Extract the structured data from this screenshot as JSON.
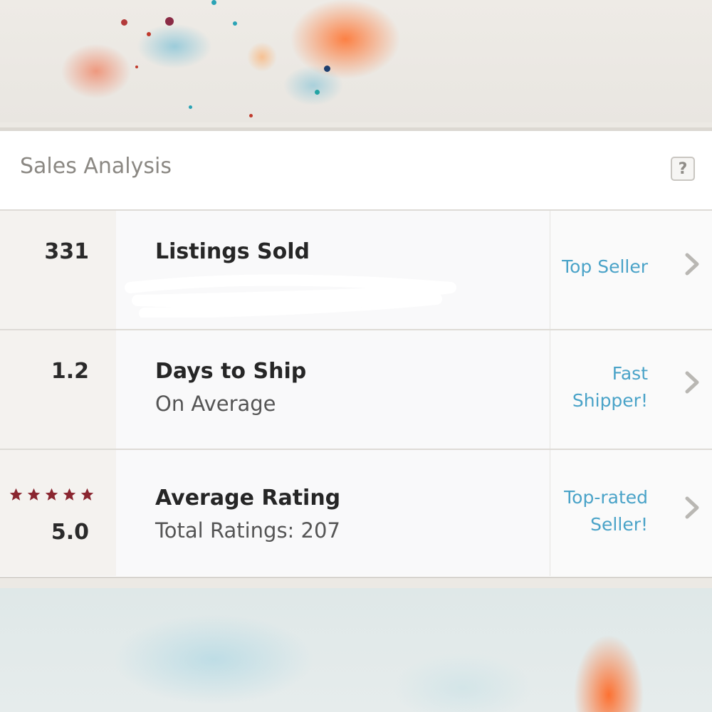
{
  "panel": {
    "title": "Sales Analysis",
    "help_label": "?"
  },
  "rows": [
    {
      "metric": "331",
      "title": "Listings Sold",
      "subtitle": "",
      "badge_line1": "Top Seller",
      "badge_line2": ""
    },
    {
      "metric": "1.2",
      "title": "Days to Ship",
      "subtitle": "On Average",
      "badge_line1": "Fast",
      "badge_line2": "Shipper!"
    },
    {
      "metric": "5.0",
      "title": "Average Rating",
      "subtitle": "Total Ratings: 207",
      "badge_line1": "Top-rated",
      "badge_line2": "Seller!",
      "stars": 5
    }
  ],
  "colors": {
    "badge": "#4aa3c8",
    "star": "#8a2630",
    "chevron": "#b9b7b3"
  },
  "icons": [
    "help-icon",
    "chevron-right-icon",
    "star-icon"
  ]
}
